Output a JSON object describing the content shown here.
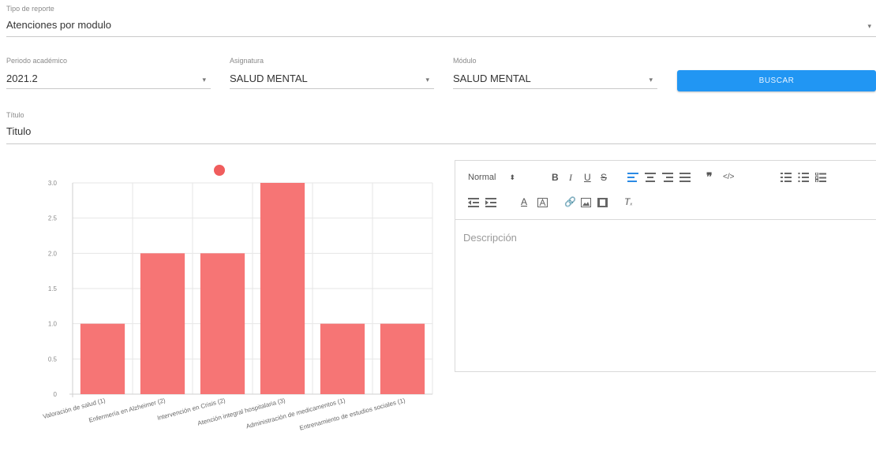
{
  "report_type": {
    "label": "Tipo de reporte",
    "value": "Atenciones por modulo"
  },
  "period": {
    "label": "Periodo académico",
    "value": "2021.2"
  },
  "subject": {
    "label": "Asignatura",
    "value": "SALUD MENTAL"
  },
  "module": {
    "label": "Módulo",
    "value": "SALUD MENTAL"
  },
  "search_button": "BUSCAR",
  "title_field": {
    "label": "Título",
    "value": "Titulo"
  },
  "editor": {
    "format_select": "Normal",
    "placeholder": "Descripción",
    "toolbar_icons": [
      "bold-icon",
      "italic-icon",
      "underline-icon",
      "strikethrough-icon",
      "align-left-icon",
      "align-center-icon",
      "align-right-icon",
      "align-justify-icon",
      "blockquote-icon",
      "code-block-icon",
      "ordered-list-icon",
      "bullet-list-icon",
      "check-list-icon",
      "outdent-icon",
      "indent-icon",
      "text-color-icon",
      "background-color-icon",
      "link-icon",
      "image-icon",
      "video-icon",
      "clear-format-icon"
    ],
    "active_icon": "align-left-icon"
  },
  "colors": {
    "accent": "#2196f3",
    "bar": "#f67575",
    "legend_dot": "#f05d5d"
  },
  "chart_data": {
    "type": "bar",
    "categories": [
      "Valoración de salud (1)",
      "Enfermería en Alzheimer (2)",
      "Intervención en Crisis (2)",
      "Atención integral hospitalaria (3)",
      "Administración de medicamentos (1)",
      "Entrenamiento de estudios sociales (1)"
    ],
    "values": [
      1,
      2,
      2,
      3,
      1,
      1
    ],
    "ylim": [
      0,
      3
    ],
    "yticks": [
      "0",
      "0.5",
      "1.0",
      "1.5",
      "2.0",
      "2.5",
      "3.0"
    ],
    "legend": "top"
  }
}
